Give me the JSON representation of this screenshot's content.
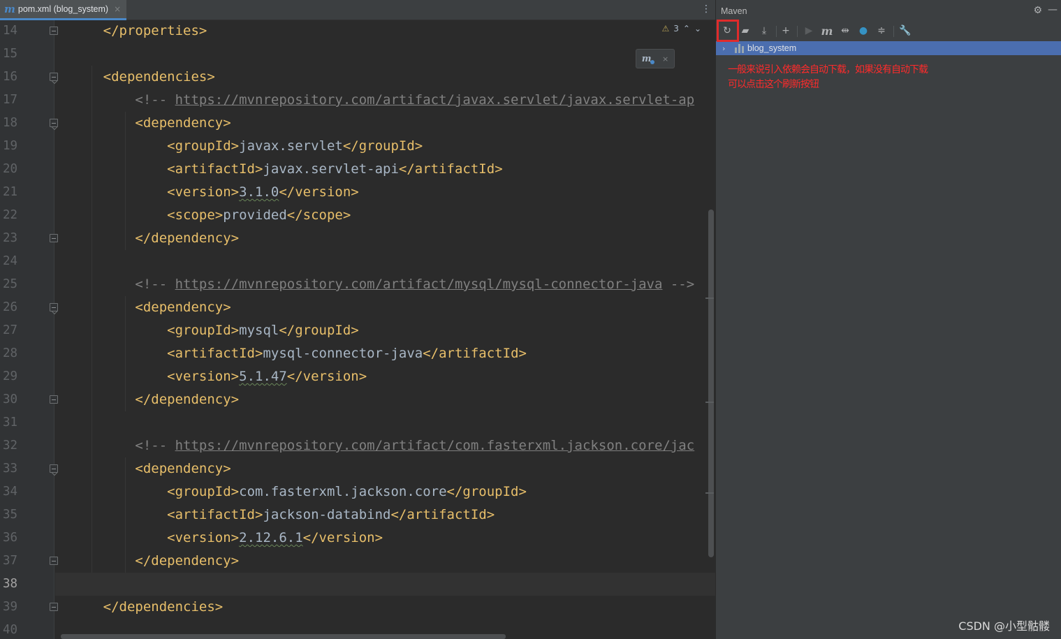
{
  "editor": {
    "tab": {
      "icon_letter": "m",
      "title": "pom.xml (blog_system)",
      "close": "×"
    },
    "tab_menu": "⋮",
    "inspection": {
      "warning_icon": "⚠",
      "warning_count": "3",
      "up": "⌃",
      "down": "⌄"
    },
    "maven_popup": {
      "icon": "m",
      "close": "×"
    },
    "current_line": 38,
    "lines": [
      {
        "n": 14,
        "segs": [
          {
            "t": "    ",
            "c": "txt"
          },
          {
            "t": "</properties>",
            "c": "tag"
          }
        ]
      },
      {
        "n": 15,
        "segs": []
      },
      {
        "n": 16,
        "segs": [
          {
            "t": "    ",
            "c": "txt"
          },
          {
            "t": "<dependencies>",
            "c": "tag"
          }
        ]
      },
      {
        "n": 17,
        "segs": [
          {
            "t": "        ",
            "c": "txt"
          },
          {
            "t": "<!-- ",
            "c": "cmt"
          },
          {
            "t": "https://mvnrepository.com/artifact/javax.servlet/javax.servlet-ap",
            "c": "url"
          }
        ]
      },
      {
        "n": 18,
        "segs": [
          {
            "t": "        ",
            "c": "txt"
          },
          {
            "t": "<dependency>",
            "c": "tag"
          }
        ]
      },
      {
        "n": 19,
        "segs": [
          {
            "t": "            ",
            "c": "txt"
          },
          {
            "t": "<groupId>",
            "c": "tag"
          },
          {
            "t": "javax.servlet",
            "c": "txt"
          },
          {
            "t": "</groupId>",
            "c": "tag"
          }
        ]
      },
      {
        "n": 20,
        "segs": [
          {
            "t": "            ",
            "c": "txt"
          },
          {
            "t": "<artifactId>",
            "c": "tag"
          },
          {
            "t": "javax.servlet-api",
            "c": "txt"
          },
          {
            "t": "</artifactId>",
            "c": "tag"
          }
        ]
      },
      {
        "n": 21,
        "segs": [
          {
            "t": "            ",
            "c": "txt"
          },
          {
            "t": "<version>",
            "c": "tag"
          },
          {
            "t": "3.1.0",
            "c": "ver"
          },
          {
            "t": "</version>",
            "c": "tag"
          }
        ]
      },
      {
        "n": 22,
        "segs": [
          {
            "t": "            ",
            "c": "txt"
          },
          {
            "t": "<scope>",
            "c": "tag"
          },
          {
            "t": "provided",
            "c": "txt"
          },
          {
            "t": "</scope>",
            "c": "tag"
          }
        ]
      },
      {
        "n": 23,
        "segs": [
          {
            "t": "        ",
            "c": "txt"
          },
          {
            "t": "</dependency>",
            "c": "tag"
          }
        ]
      },
      {
        "n": 24,
        "segs": []
      },
      {
        "n": 25,
        "segs": [
          {
            "t": "        ",
            "c": "txt"
          },
          {
            "t": "<!-- ",
            "c": "cmt"
          },
          {
            "t": "https://mvnrepository.com/artifact/mysql/mysql-connector-java",
            "c": "url"
          },
          {
            "t": " -->",
            "c": "cmt"
          }
        ]
      },
      {
        "n": 26,
        "segs": [
          {
            "t": "        ",
            "c": "txt"
          },
          {
            "t": "<dependency>",
            "c": "tag"
          }
        ]
      },
      {
        "n": 27,
        "segs": [
          {
            "t": "            ",
            "c": "txt"
          },
          {
            "t": "<groupId>",
            "c": "tag"
          },
          {
            "t": "mysql",
            "c": "txt"
          },
          {
            "t": "</groupId>",
            "c": "tag"
          }
        ]
      },
      {
        "n": 28,
        "segs": [
          {
            "t": "            ",
            "c": "txt"
          },
          {
            "t": "<artifactId>",
            "c": "tag"
          },
          {
            "t": "mysql-connector-java",
            "c": "txt"
          },
          {
            "t": "</artifactId>",
            "c": "tag"
          }
        ]
      },
      {
        "n": 29,
        "segs": [
          {
            "t": "            ",
            "c": "txt"
          },
          {
            "t": "<version>",
            "c": "tag"
          },
          {
            "t": "5.1.47",
            "c": "ver"
          },
          {
            "t": "</version>",
            "c": "tag"
          }
        ]
      },
      {
        "n": 30,
        "segs": [
          {
            "t": "        ",
            "c": "txt"
          },
          {
            "t": "</dependency>",
            "c": "tag"
          }
        ]
      },
      {
        "n": 31,
        "segs": []
      },
      {
        "n": 32,
        "segs": [
          {
            "t": "        ",
            "c": "txt"
          },
          {
            "t": "<!-- ",
            "c": "cmt"
          },
          {
            "t": "https://mvnrepository.com/artifact/com.fasterxml.jackson.core/jac",
            "c": "url"
          }
        ]
      },
      {
        "n": 33,
        "segs": [
          {
            "t": "        ",
            "c": "txt"
          },
          {
            "t": "<dependency>",
            "c": "tag"
          }
        ]
      },
      {
        "n": 34,
        "segs": [
          {
            "t": "            ",
            "c": "txt"
          },
          {
            "t": "<groupId>",
            "c": "tag"
          },
          {
            "t": "com.fasterxml.jackson.core",
            "c": "txt"
          },
          {
            "t": "</groupId>",
            "c": "tag"
          }
        ]
      },
      {
        "n": 35,
        "segs": [
          {
            "t": "            ",
            "c": "txt"
          },
          {
            "t": "<artifactId>",
            "c": "tag"
          },
          {
            "t": "jackson-databind",
            "c": "txt"
          },
          {
            "t": "</artifactId>",
            "c": "tag"
          }
        ]
      },
      {
        "n": 36,
        "segs": [
          {
            "t": "            ",
            "c": "txt"
          },
          {
            "t": "<version>",
            "c": "tag"
          },
          {
            "t": "2.12.6.1",
            "c": "ver"
          },
          {
            "t": "</version>",
            "c": "tag"
          }
        ]
      },
      {
        "n": 37,
        "segs": [
          {
            "t": "        ",
            "c": "txt"
          },
          {
            "t": "</dependency>",
            "c": "tag"
          }
        ]
      },
      {
        "n": 38,
        "segs": []
      },
      {
        "n": 39,
        "segs": [
          {
            "t": "    ",
            "c": "txt"
          },
          {
            "t": "</dependencies>",
            "c": "tag"
          }
        ]
      },
      {
        "n": 40,
        "segs": []
      }
    ]
  },
  "maven": {
    "title": "Maven",
    "gear_icon": "⚙",
    "minimize_icon": "—",
    "toolbar": {
      "reload": "↻",
      "add_folder": "▰",
      "download": "⤓",
      "add": "+",
      "run": "▶",
      "execute_goal": "m",
      "toggle_offline": "⇹",
      "skip_tests": "●",
      "collapse": "≑",
      "settings": "🔧"
    },
    "tree": {
      "chevron": "›",
      "project": "blog_system"
    },
    "note_line1": "一般来说引入依赖会自动下载，如果没有自动下载",
    "note_line2": "可以点击这个刷新按钮"
  },
  "watermark": "CSDN @小型骷髅",
  "colors": {
    "editor_bg": "#2b2b2b",
    "tag": "#e8bf6a",
    "comment": "#808080",
    "text": "#a9b7c6",
    "selection": "#4b6eaf",
    "highlight_box": "#e02b2b",
    "note": "#ff2b2b"
  }
}
